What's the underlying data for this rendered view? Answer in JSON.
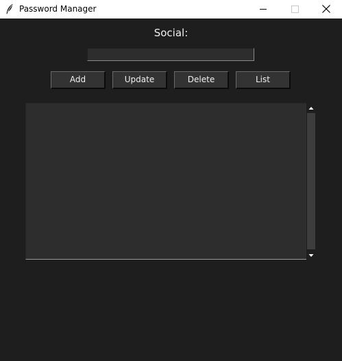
{
  "window": {
    "title": "Password Manager",
    "icon": "feather-icon",
    "controls": [
      "minimize-icon",
      "maximize-icon",
      "close-icon"
    ]
  },
  "form": {
    "label": "Social:",
    "entry_value": "",
    "entry_placeholder": ""
  },
  "buttons": {
    "add": "Add",
    "update": "Update",
    "delete": "Delete",
    "list": "List"
  },
  "output": {
    "content": ""
  },
  "colors": {
    "background": "#1e1e1e",
    "field": "#2d2d2d",
    "button": "#333333",
    "text": "#f0f0f0",
    "titlebar": "#ffffff"
  }
}
